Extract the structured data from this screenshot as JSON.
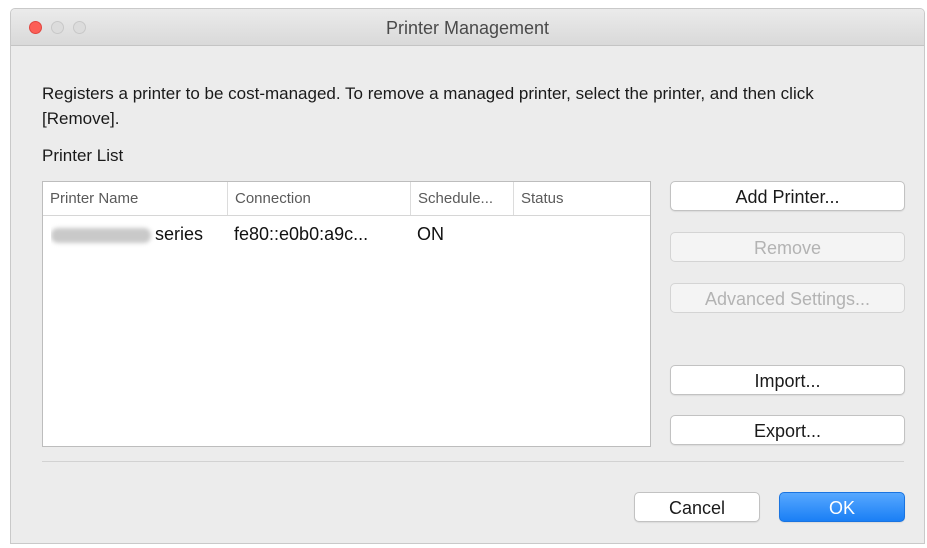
{
  "window": {
    "title": "Printer Management"
  },
  "description": "Registers a printer to be cost-managed. To remove a managed printer, select the printer, and then click [Remove].",
  "printer_list": {
    "label": "Printer List",
    "columns": [
      "Printer Name",
      "Connection",
      "Schedule...",
      "Status"
    ],
    "rows": [
      {
        "name_suffix": "series",
        "connection": "fe80::e0b0:a9c...",
        "schedule": "ON",
        "status": ""
      }
    ]
  },
  "side_buttons": {
    "add_printer": "Add Printer...",
    "remove": "Remove",
    "advanced_settings": "Advanced Settings...",
    "import": "Import...",
    "export": "Export..."
  },
  "footer": {
    "cancel": "Cancel",
    "ok": "OK"
  },
  "colors": {
    "accent": "#1a7ff5",
    "close": "#fc5f57"
  }
}
